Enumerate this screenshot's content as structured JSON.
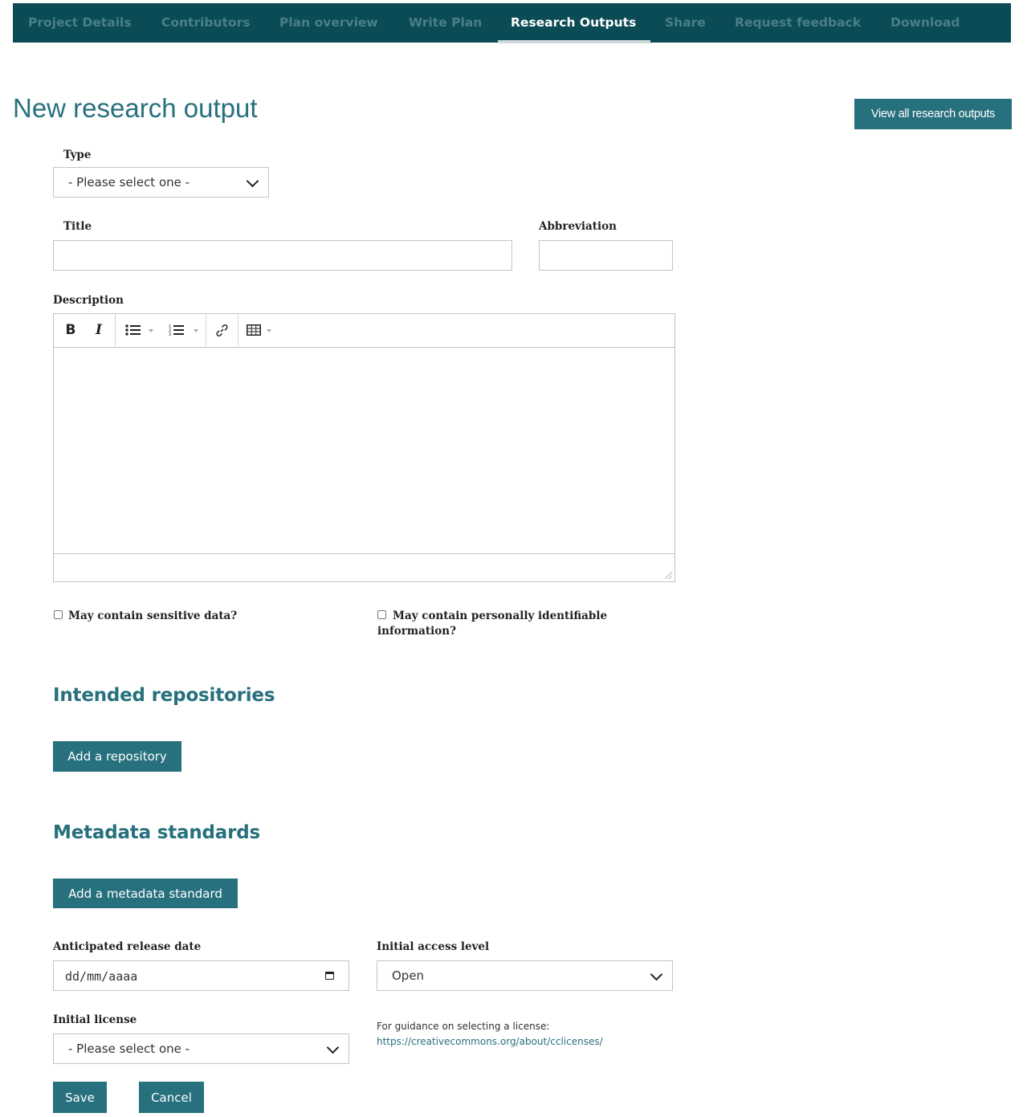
{
  "nav": {
    "tabs": [
      {
        "label": "Project Details"
      },
      {
        "label": "Contributors"
      },
      {
        "label": "Plan overview"
      },
      {
        "label": "Write Plan"
      },
      {
        "label": "Research Outputs"
      },
      {
        "label": "Share"
      },
      {
        "label": "Request feedback"
      },
      {
        "label": "Download"
      }
    ],
    "active_tab": "Research Outputs"
  },
  "header": {
    "title": "New research output",
    "view_all_label": "View all research outputs"
  },
  "form": {
    "type": {
      "label": "Type",
      "value": "- Please select one -"
    },
    "title": {
      "label": "Title",
      "value": ""
    },
    "abbreviation": {
      "label": "Abbreviation",
      "value": ""
    },
    "description": {
      "label": "Description",
      "value": ""
    },
    "sensitive": {
      "label": "May contain sensitive data?",
      "checked": false
    },
    "pii": {
      "label": "May contain personally identifiable information?",
      "checked": false
    },
    "release_date": {
      "label": "Anticipated release date",
      "placeholder": "dd/mm/aaaa"
    },
    "access_level": {
      "label": "Initial access level",
      "value": "Open"
    },
    "license": {
      "label": "Initial license",
      "value": "- Please select one -"
    },
    "license_guidance": {
      "text": "For guidance on selecting a license:",
      "link": "https://creativecommons.org/about/cclicenses/"
    }
  },
  "repositories": {
    "heading": "Intended repositories",
    "add_label": "Add a repository"
  },
  "metadata": {
    "heading": "Metadata standards",
    "add_label": "Add a metadata standard"
  },
  "actions": {
    "save_label": "Save",
    "cancel_label": "Cancel"
  },
  "colors": {
    "nav_bg": "#0b4b55",
    "accent": "#27707d"
  }
}
